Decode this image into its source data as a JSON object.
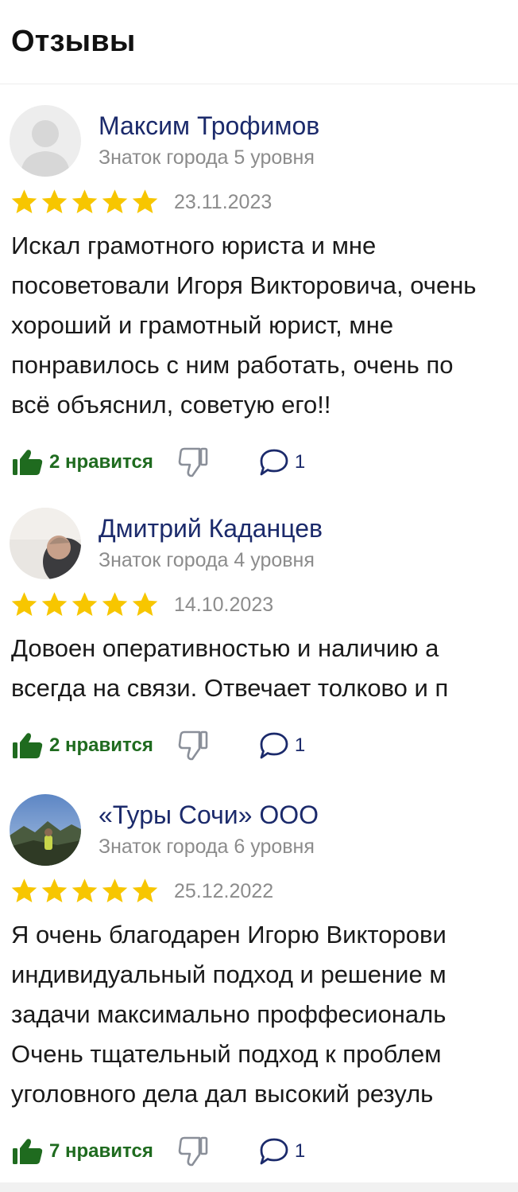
{
  "header": {
    "title": "Отзывы"
  },
  "reviews": [
    {
      "author": "Максим Трофимов",
      "level": "Знаток города 5 уровня",
      "rating": 5,
      "date": "23.11.2023",
      "text": [
        "Искал грамотного юриста и мне",
        "посоветовали Игоря Викторовича, очень",
        "хороший и грамотный юрист, мне",
        "понравилось с ним работать, очень по",
        "всё объяснил, советую его!!"
      ],
      "likes": "2 нравится",
      "comments": "1"
    },
    {
      "author": "Дмитрий Каданцев",
      "level": "Знаток города 4 уровня",
      "rating": 5,
      "date": "14.10.2023",
      "text": [
        "Довоен оперативностью и наличию а",
        "всегда на связи. Отвечает толково и п"
      ],
      "likes": "2 нравится",
      "comments": "1"
    },
    {
      "author": "«Туры Сочи» ООО",
      "level": "Знаток города 6 уровня",
      "rating": 5,
      "date": "25.12.2022",
      "text": [
        "Я очень благодарен Игорю Викторови",
        "индивидуальный подход и решение м",
        "задачи максимально проффесиональ",
        "Очень тщательный подход к проблем",
        "уголовного дела дал высокий резуль"
      ],
      "likes": "7 нравится",
      "comments": "1"
    }
  ],
  "colors": {
    "star": "#f7c600",
    "author": "#1b2a6b",
    "like": "#1f6b1f",
    "muted": "#8c8c8c"
  },
  "icons": [
    "thumbs-up-icon",
    "thumbs-down-icon",
    "comment-icon",
    "star-icon"
  ]
}
